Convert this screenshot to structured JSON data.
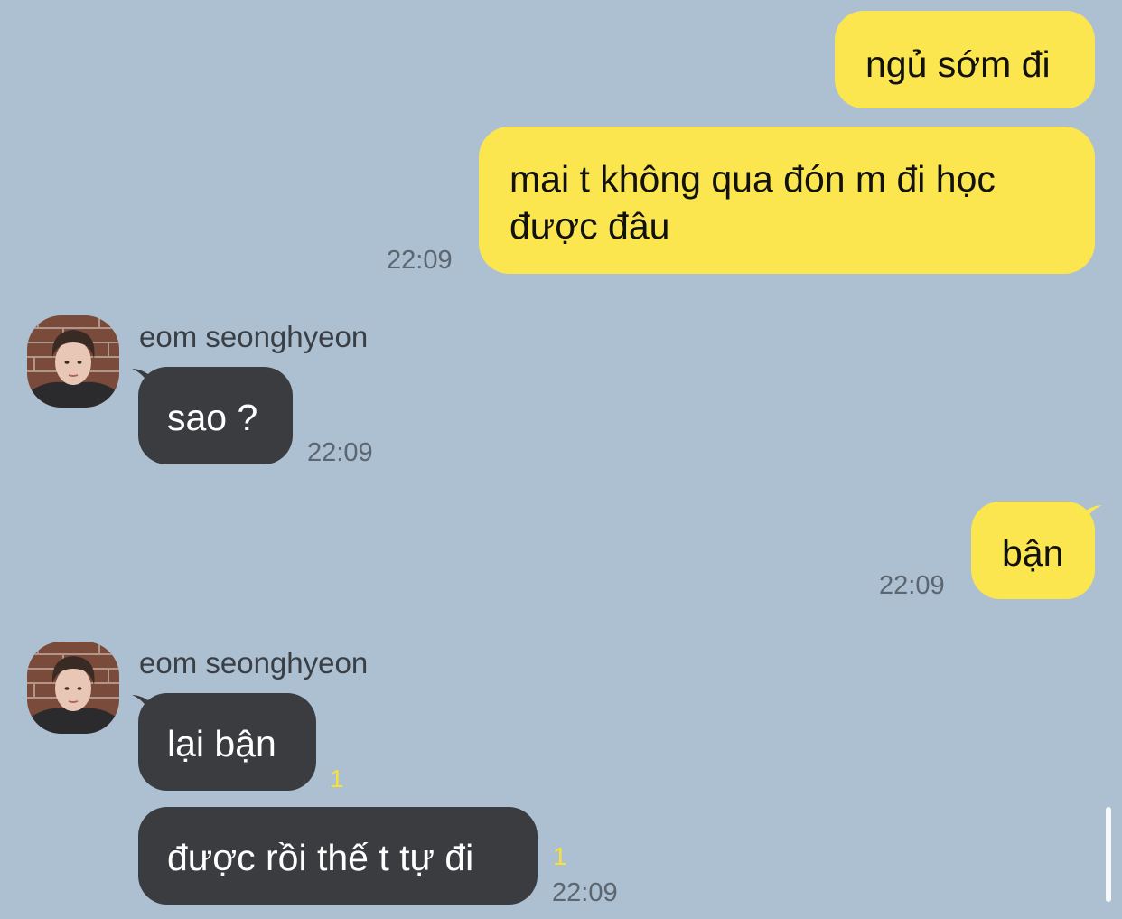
{
  "messages": {
    "m1": {
      "text": "ngủ sớm đi"
    },
    "m2": {
      "line1": "mai t không qua đón m đi học",
      "line2": "được đâu",
      "time": "22:09"
    },
    "m3": {
      "sender": "eom seonghyeon",
      "text": "sao ?",
      "time": "22:09"
    },
    "m4": {
      "text": "bận",
      "time": "22:09"
    },
    "m5": {
      "sender": "eom seonghyeon",
      "text": "lại bận",
      "unread": "1"
    },
    "m6": {
      "text": "được rồi thế t tự đi",
      "unread": "1",
      "time": "22:09"
    }
  },
  "colors": {
    "background": "#adc0d1",
    "my_bubble": "#fbe64f",
    "their_bubble": "#3b3c40",
    "unread_count": "#f6e13c"
  },
  "icons": {
    "avatar": "profile-photo"
  }
}
